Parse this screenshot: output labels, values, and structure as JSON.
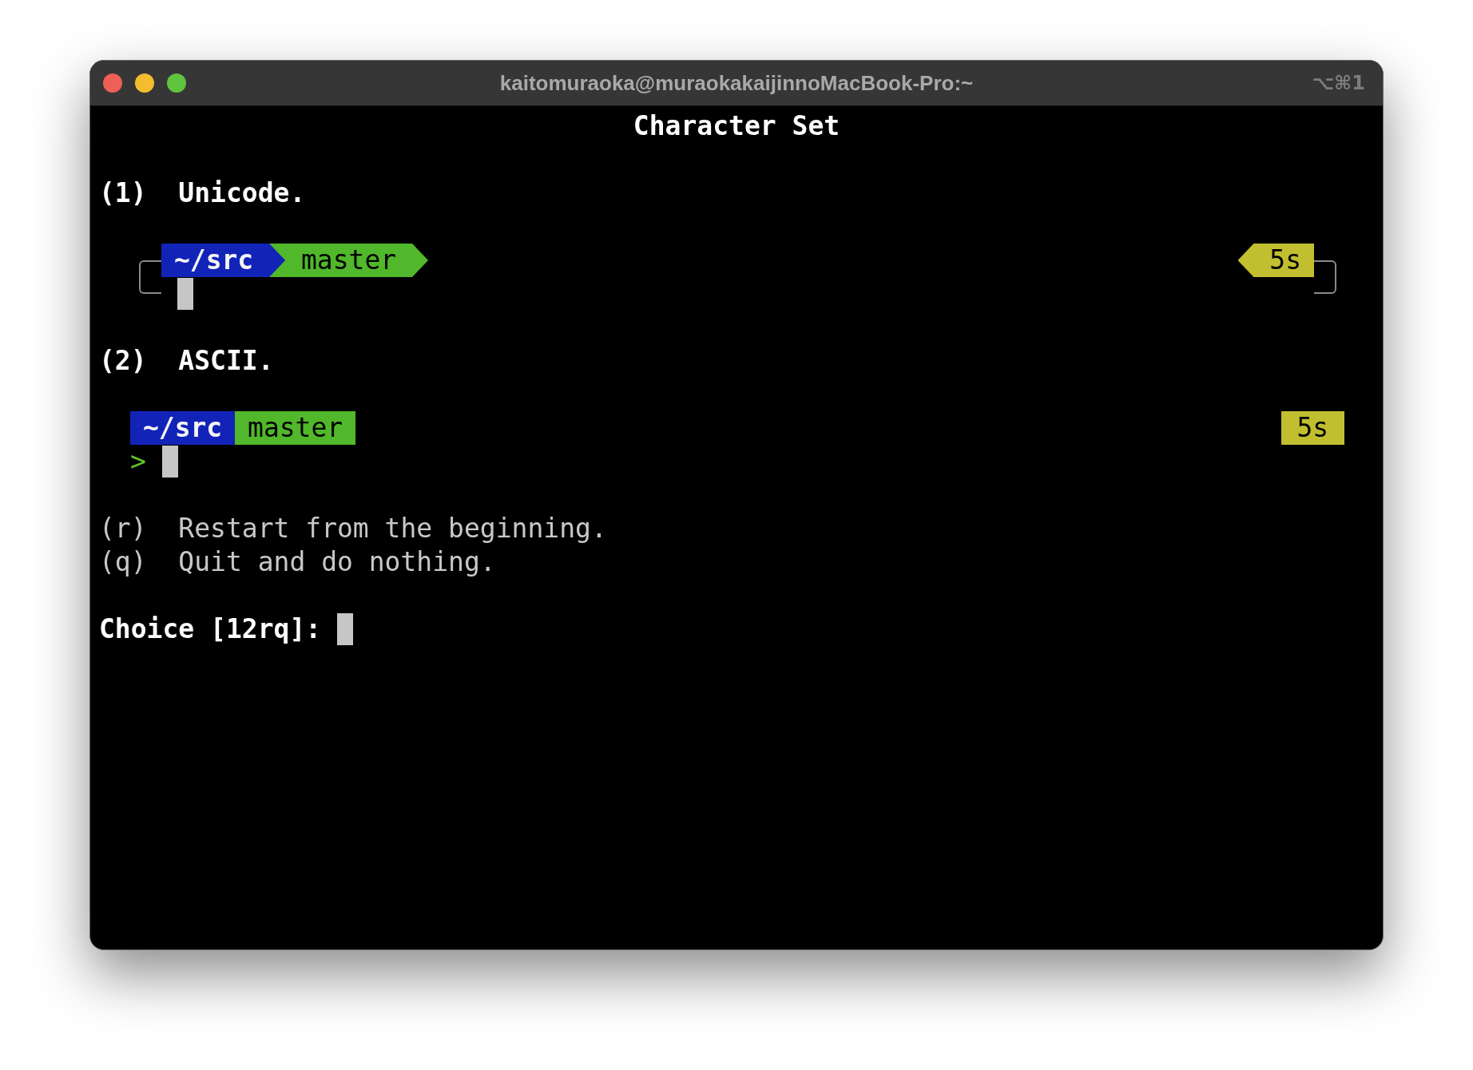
{
  "window": {
    "title": "kaitomuraoka@muraokakaijinnoMacBook-Pro:~",
    "shortcut": "⌥⌘1"
  },
  "heading": "Character Set",
  "options": [
    {
      "key": "(1)",
      "label": "Unicode.",
      "kind": "unicode",
      "segments": [
        {
          "kind": "dir",
          "text": "~/src"
        },
        {
          "kind": "vcs",
          "text": "master"
        }
      ],
      "right_segments": [
        {
          "kind": "duration",
          "text": "5s"
        }
      ]
    },
    {
      "key": "(2)",
      "label": "ASCII.",
      "kind": "ascii",
      "segments": [
        {
          "kind": "dir",
          "text": "~/src"
        },
        {
          "kind": "vcs",
          "text": "master"
        }
      ],
      "right_segments": [
        {
          "kind": "duration",
          "text": "5s"
        }
      ],
      "prompt_char": ">"
    }
  ],
  "actions": [
    {
      "key": "(r)",
      "label": "Restart from the beginning."
    },
    {
      "key": "(q)",
      "label": "Quit and do nothing."
    }
  ],
  "choice": {
    "label": "Choice [12rq]:"
  }
}
